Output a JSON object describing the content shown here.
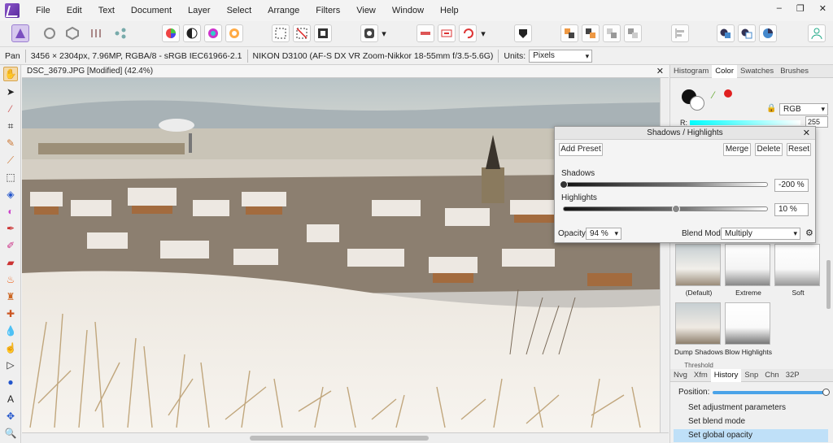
{
  "app": {
    "name": "Affinity Photo"
  },
  "menu": [
    "File",
    "Edit",
    "Text",
    "Document",
    "Layer",
    "Select",
    "Arrange",
    "Filters",
    "View",
    "Window",
    "Help"
  ],
  "context": {
    "tool": "Pan",
    "image_info": "3456 × 2304px, 7.96MP, RGBA/8 - sRGB IEC61966-2.1",
    "camera": "NIKON D3100 (AF-S DX VR Zoom-Nikkor 18-55mm f/3.5-5.6G)",
    "units_label": "Units:",
    "units_value": "Pixels"
  },
  "document": {
    "title": "DSC_3679.JPG [Modified] (42.4%)"
  },
  "right_panel": {
    "top_tabs": [
      "Histogram",
      "Color",
      "Swatches",
      "Brushes"
    ],
    "active_top_tab": "Color",
    "color_model": "RGB",
    "r_label": "R:",
    "r_value": "255"
  },
  "dialog": {
    "title": "Shadows / Highlights",
    "buttons": {
      "add_preset": "Add Preset",
      "merge": "Merge",
      "delete": "Delete",
      "reset": "Reset"
    },
    "shadows": {
      "label": "Shadows",
      "value": "-200 %",
      "fraction": 0.0
    },
    "highlights": {
      "label": "Highlights",
      "value": "10 %",
      "fraction": 0.55
    },
    "opacity": {
      "label": "Opacity:",
      "value": "94 %"
    },
    "blend": {
      "label": "Blend Mode:",
      "value": "Multiply"
    }
  },
  "presets": [
    {
      "label": "(Default)"
    },
    {
      "label": "Extreme"
    },
    {
      "label": "Soft"
    },
    {
      "label": "Dump Shadows"
    },
    {
      "label": "Blow Highlights"
    },
    {
      "label": "Threshold"
    }
  ],
  "bottom_panel": {
    "tabs": [
      "Nvg",
      "Xfm",
      "History",
      "Snp",
      "Chn",
      "32P"
    ],
    "active_tab": "History",
    "position_label": "Position:",
    "history": [
      "Set adjustment parameters",
      "Set blend mode",
      "Set global opacity"
    ],
    "selected_index": 2
  },
  "colors": {
    "accent": "#7b4fc0",
    "selection": "#bfe0f8",
    "primary_red": "#e02020"
  }
}
